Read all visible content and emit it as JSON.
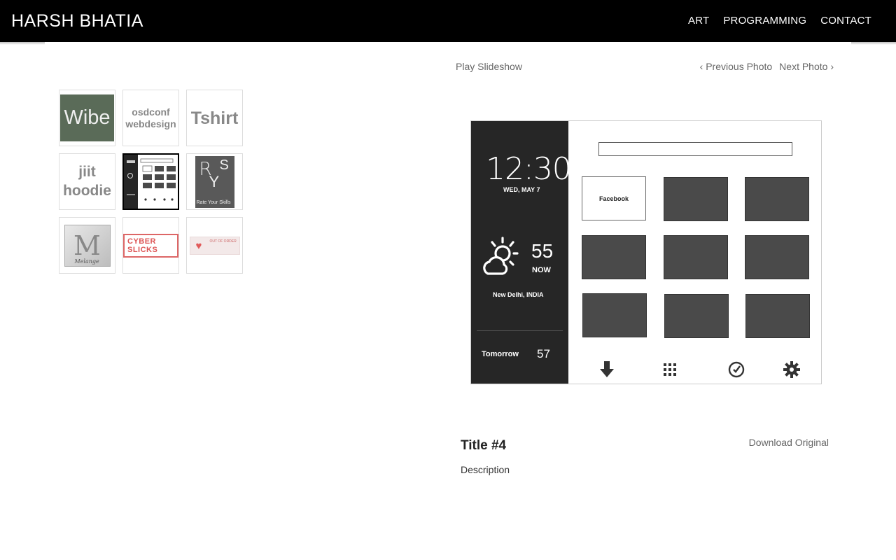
{
  "header": {
    "brand": "HARSH BHATIA",
    "nav": [
      "ART",
      "PROGRAMMING",
      "CONTACT"
    ]
  },
  "gallery": {
    "thumbnails": [
      {
        "label": "Wibe"
      },
      {
        "label_line1": "osdconf",
        "label_line2": "webdesign"
      },
      {
        "label": "Tshirt"
      },
      {
        "label_line1": "jiit",
        "label_line2": "hoodie"
      },
      {
        "label": "",
        "selected": true
      },
      {
        "letters": [
          "R",
          "S",
          "Y"
        ],
        "caption": "Rate Your Skills"
      },
      {
        "letter": "M",
        "caption": "Melange"
      },
      {
        "label": "CYBER SLICKS"
      },
      {
        "label": "OUT OF ORDER"
      }
    ]
  },
  "controls": {
    "slideshow": "Play Slideshow",
    "previous": "‹ Previous Photo",
    "next": "Next Photo ›"
  },
  "photo": {
    "time": "12:30",
    "date": "WED, MAY 7",
    "temperature": "55",
    "now_label": "NOW",
    "city": "New Delhi, INDIA",
    "tomorrow_label": "Tomorrow",
    "tomorrow_temp": "57",
    "first_tile": "Facebook",
    "dock_icons": [
      "download-icon",
      "apps-grid-icon",
      "clock-icon",
      "gear-icon"
    ]
  },
  "caption": {
    "title": "Title #4",
    "description": "Description",
    "download": "Download Original"
  }
}
